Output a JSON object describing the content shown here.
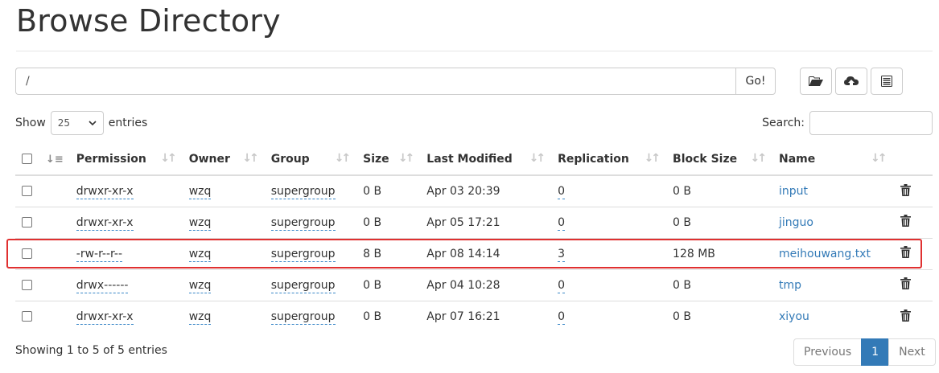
{
  "page": {
    "title": "Browse Directory"
  },
  "path_bar": {
    "value": "/",
    "go_label": "Go!"
  },
  "toolbar": {
    "icons": [
      "folder-open-icon",
      "cloud-upload-icon",
      "list-alt-icon"
    ]
  },
  "length": {
    "show_label": "Show",
    "value": "25",
    "entries_label": "entries"
  },
  "search": {
    "label": "Search:",
    "value": ""
  },
  "table": {
    "columns": [
      "Permission",
      "Owner",
      "Group",
      "Size",
      "Last Modified",
      "Replication",
      "Block Size",
      "Name"
    ],
    "rows": [
      {
        "permission": "drwxr-xr-x",
        "owner": "wzq",
        "group": "supergroup",
        "size": "0 B",
        "modified": "Apr 03 20:39",
        "replication": "0",
        "block_size": "0 B",
        "name": "input"
      },
      {
        "permission": "drwxr-xr-x",
        "owner": "wzq",
        "group": "supergroup",
        "size": "0 B",
        "modified": "Apr 05 17:21",
        "replication": "0",
        "block_size": "0 B",
        "name": "jinguo"
      },
      {
        "permission": "-rw-r--r--",
        "owner": "wzq",
        "group": "supergroup",
        "size": "8 B",
        "modified": "Apr 08 14:14",
        "replication": "3",
        "block_size": "128 MB",
        "name": "meihouwang.txt"
      },
      {
        "permission": "drwx------",
        "owner": "wzq",
        "group": "supergroup",
        "size": "0 B",
        "modified": "Apr 04 10:28",
        "replication": "0",
        "block_size": "0 B",
        "name": "tmp"
      },
      {
        "permission": "drwxr-xr-x",
        "owner": "wzq",
        "group": "supergroup",
        "size": "0 B",
        "modified": "Apr 07 16:21",
        "replication": "0",
        "block_size": "0 B",
        "name": "xiyou"
      }
    ]
  },
  "footer": {
    "info": "Showing 1 to 5 of 5 entries",
    "previous": "Previous",
    "page": "1",
    "next": "Next"
  },
  "colors": {
    "link": "#337ab7",
    "highlight": "#e03030",
    "active_page": "#337ab7"
  }
}
